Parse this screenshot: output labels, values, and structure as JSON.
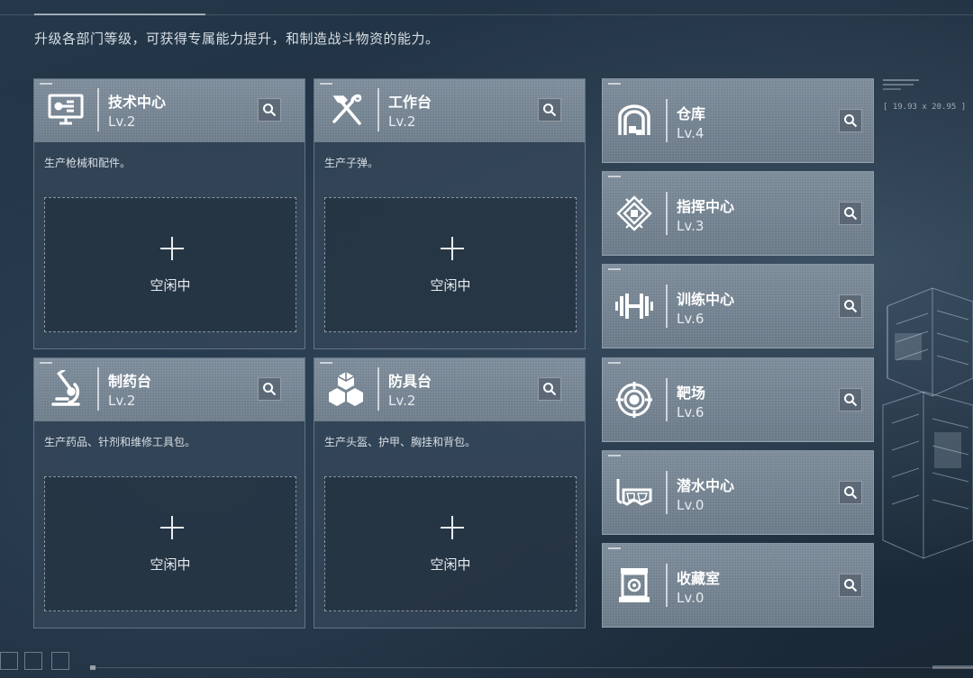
{
  "intro_text": "升级各部门等级，可获得专属能力提升，和制造战斗物资的能力。",
  "hud": {
    "coord": "[ 19.93 x 20.95 ]"
  },
  "slot_label": "空闲中",
  "workshops": [
    {
      "name": "技术中心",
      "level": "Lv.2",
      "desc": "生产枪械和配件。",
      "icon": "computer-icon"
    },
    {
      "name": "工作台",
      "level": "Lv.2",
      "desc": "生产子弹。",
      "icon": "hammer-wrench-icon"
    },
    {
      "name": "制药台",
      "level": "Lv.2",
      "desc": "生产药品、针剂和维修工具包。",
      "icon": "microscope-icon"
    },
    {
      "name": "防具台",
      "level": "Lv.2",
      "desc": "生产头盔、护甲、胸挂和背包。",
      "icon": "cubes-icon"
    }
  ],
  "facilities": [
    {
      "name": "仓库",
      "level": "Lv.4",
      "icon": "warehouse-icon"
    },
    {
      "name": "指挥中心",
      "level": "Lv.3",
      "icon": "command-emblem-icon"
    },
    {
      "name": "训练中心",
      "level": "Lv.6",
      "icon": "dumbbell-icon"
    },
    {
      "name": "靶场",
      "level": "Lv.6",
      "icon": "target-icon"
    },
    {
      "name": "潜水中心",
      "level": "Lv.0",
      "icon": "diving-mask-icon"
    },
    {
      "name": "收藏室",
      "level": "Lv.0",
      "icon": "display-case-icon"
    }
  ],
  "colors": {
    "background": "#1d2d3d",
    "header": "#7c8b99",
    "card_body": "#34465a"
  }
}
